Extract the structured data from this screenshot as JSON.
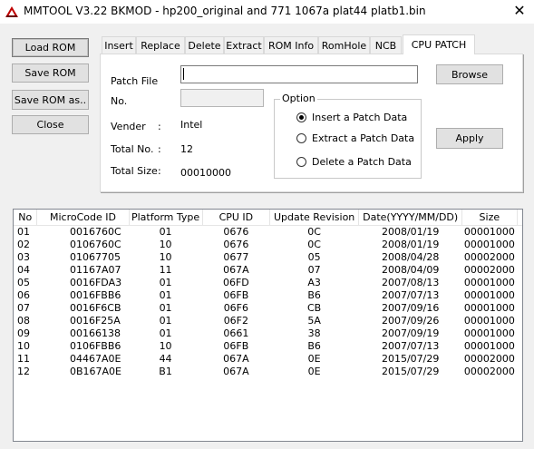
{
  "window": {
    "title": "MMTOOL V3.22 BKMOD - hp200_original and 771 1067a plat44 platb1.bin",
    "close_glyph": "✕"
  },
  "sidebar": {
    "load_rom": "Load ROM",
    "save_rom": "Save ROM",
    "save_rom_as": "Save ROM as..",
    "close": "Close"
  },
  "tabs": [
    {
      "label": "Insert"
    },
    {
      "label": "Replace"
    },
    {
      "label": "Delete"
    },
    {
      "label": "Extract"
    },
    {
      "label": "ROM Info"
    },
    {
      "label": "RomHole"
    },
    {
      "label": "NCB"
    },
    {
      "label": "CPU PATCH",
      "active": true
    }
  ],
  "cpu_patch": {
    "patch_file_label": "Patch File",
    "patch_file_value": "",
    "no_label": "No.",
    "no_value": "",
    "vender_label": "Vender",
    "vender_sep": ":",
    "vender_value": "Intel",
    "total_no_label": "Total No.",
    "total_no_sep": ":",
    "total_no_value": "12",
    "total_size_label": "Total Size",
    "total_size_sep": ":",
    "total_size_value": "00010000",
    "browse_label": "Browse",
    "apply_label": "Apply",
    "option_legend": "Option",
    "options": [
      {
        "label": "Insert a Patch Data",
        "selected": true
      },
      {
        "label": "Extract a Patch Data",
        "selected": false
      },
      {
        "label": "Delete a Patch Data",
        "selected": false
      }
    ]
  },
  "table": {
    "columns": [
      "No",
      "MicroCode ID",
      "Platform Type",
      "CPU ID",
      "Update Revision",
      "Date(YYYY/MM/DD)",
      "Size"
    ],
    "rows": [
      [
        "01",
        "0016760C",
        "01",
        "0676",
        "0C",
        "2008/01/19",
        "00001000"
      ],
      [
        "02",
        "0106760C",
        "10",
        "0676",
        "0C",
        "2008/01/19",
        "00001000"
      ],
      [
        "03",
        "01067705",
        "10",
        "0677",
        "05",
        "2008/04/28",
        "00002000"
      ],
      [
        "04",
        "01167A07",
        "11",
        "067A",
        "07",
        "2008/04/09",
        "00002000"
      ],
      [
        "05",
        "0016FDA3",
        "01",
        "06FD",
        "A3",
        "2007/08/13",
        "00001000"
      ],
      [
        "06",
        "0016FBB6",
        "01",
        "06FB",
        "B6",
        "2007/07/13",
        "00001000"
      ],
      [
        "07",
        "0016F6CB",
        "01",
        "06F6",
        "CB",
        "2007/09/16",
        "00001000"
      ],
      [
        "08",
        "0016F25A",
        "01",
        "06F2",
        "5A",
        "2007/09/26",
        "00001000"
      ],
      [
        "09",
        "00166138",
        "01",
        "0661",
        "38",
        "2007/09/19",
        "00001000"
      ],
      [
        "10",
        "0106FBB6",
        "10",
        "06FB",
        "B6",
        "2007/07/13",
        "00001000"
      ],
      [
        "11",
        "04467A0E",
        "44",
        "067A",
        "0E",
        "2015/07/29",
        "00002000"
      ],
      [
        "12",
        "0B167A0E",
        "B1",
        "067A",
        "0E",
        "2015/07/29",
        "00002000"
      ]
    ]
  }
}
